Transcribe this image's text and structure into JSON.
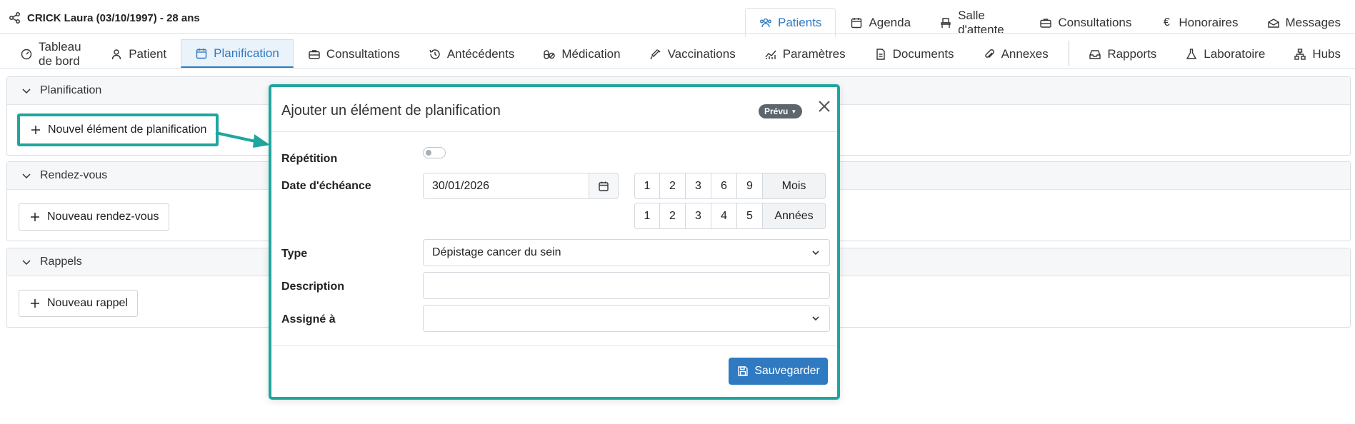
{
  "patient": {
    "title": "CRICK Laura (03/10/1997) - 28 ans"
  },
  "top_nav": [
    {
      "label": "Patients",
      "icon": "users-icon",
      "active": true
    },
    {
      "label": "Agenda",
      "icon": "calendar-icon",
      "active": false
    },
    {
      "label": "Salle d'attente",
      "icon": "chair-icon",
      "active": false
    },
    {
      "label": "Consultations",
      "icon": "briefcase-icon",
      "active": false
    },
    {
      "label": "Honoraires",
      "icon": "euro-icon",
      "active": false
    },
    {
      "label": "Messages",
      "icon": "mail-icon",
      "active": false
    }
  ],
  "sub_nav": [
    {
      "label": "Tableau de bord",
      "icon": "dashboard-icon"
    },
    {
      "label": "Patient",
      "icon": "user-icon"
    },
    {
      "label": "Planification",
      "icon": "calendar-icon",
      "active": true
    },
    {
      "label": "Consultations",
      "icon": "briefcase-icon"
    },
    {
      "label": "Antécédents",
      "icon": "history-icon"
    },
    {
      "label": "Médication",
      "icon": "pills-icon"
    },
    {
      "label": "Vaccinations",
      "icon": "syringe-icon"
    },
    {
      "label": "Paramètres",
      "icon": "chart-icon"
    },
    {
      "label": "Documents",
      "icon": "file-icon"
    },
    {
      "label": "Annexes",
      "icon": "paperclip-icon"
    },
    {
      "label": "Rapports",
      "icon": "inbox-icon"
    },
    {
      "label": "Laboratoire",
      "icon": "flask-icon"
    },
    {
      "label": "Hubs",
      "icon": "network-icon"
    }
  ],
  "panels": {
    "planification": {
      "title": "Planification",
      "button": "Nouvel élément de planification"
    },
    "rendezvous": {
      "title": "Rendez-vous",
      "button": "Nouveau rendez-vous"
    },
    "rappels": {
      "title": "Rappels",
      "button": "Nouveau rappel"
    }
  },
  "modal": {
    "title": "Ajouter un élément de planification",
    "badge": "Prévu",
    "labels": {
      "repetition": "Répétition",
      "due_date": "Date d'échéance",
      "type": "Type",
      "description": "Description",
      "assigned": "Assigné à"
    },
    "due_date_value": "30/01/2026",
    "month_buttons": [
      "1",
      "2",
      "3",
      "6",
      "9"
    ],
    "month_unit": "Mois",
    "year_buttons": [
      "1",
      "2",
      "3",
      "4",
      "5"
    ],
    "year_unit": "Années",
    "type_value": "Dépistage cancer du sein",
    "description_value": "",
    "assigned_value": "",
    "save_label": "Sauvegarder"
  },
  "colors": {
    "accent": "#2f7ac1",
    "highlight": "#1ea69f"
  }
}
